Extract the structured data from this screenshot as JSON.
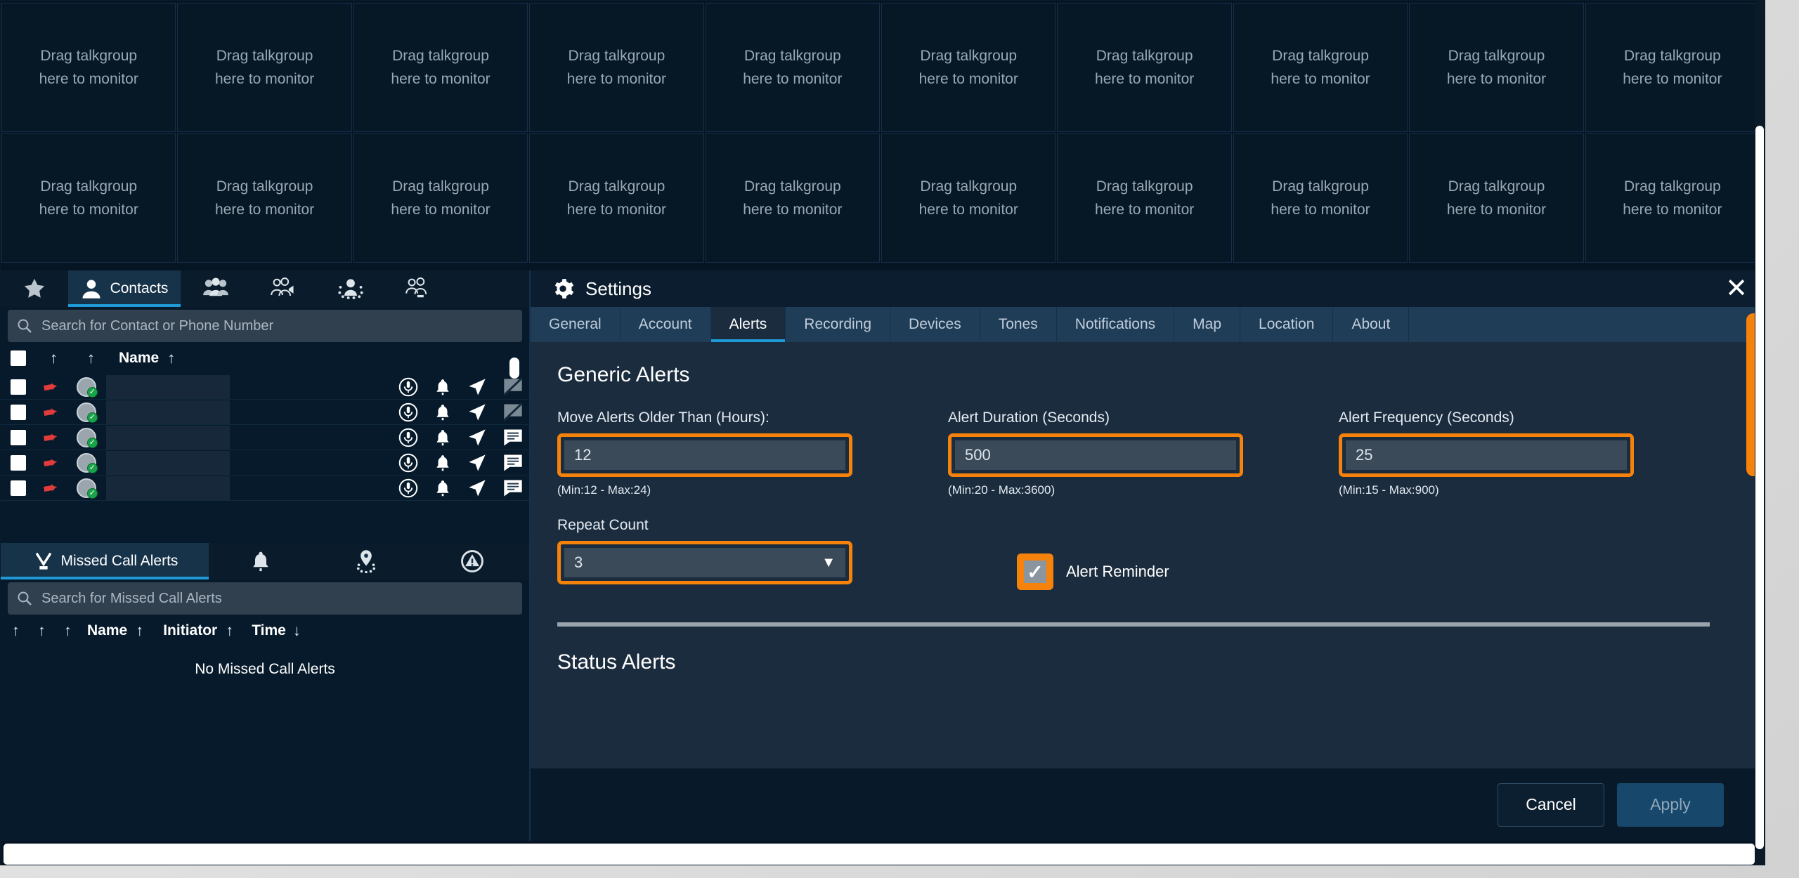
{
  "talkgroups": {
    "placeholder_line1": "Drag talkgroup",
    "placeholder_line2": "here to monitor",
    "columns": 10,
    "rows": 2
  },
  "left_panel": {
    "contacts_tabs": [
      {
        "label": "",
        "icon": "star-icon",
        "active": false
      },
      {
        "label": "Contacts",
        "icon": "person-icon",
        "active": true
      },
      {
        "label": "",
        "icon": "group-icon",
        "active": false
      },
      {
        "label": "",
        "icon": "talkgroup-broadcast-icon",
        "active": false
      },
      {
        "label": "",
        "icon": "group-dashed-icon",
        "active": false
      },
      {
        "label": "",
        "icon": "group-download-icon",
        "active": false
      }
    ],
    "contacts_search_placeholder": "Search for Contact or Phone Number",
    "contacts_columns": [
      "Name"
    ],
    "contact_rows": [
      {
        "chat": "chat-off-icon"
      },
      {
        "chat": "chat-off-icon"
      },
      {
        "chat": "chat-icon"
      },
      {
        "chat": "chat-icon"
      },
      {
        "chat": "chat-icon"
      }
    ],
    "missed_tabs": [
      {
        "label": "Missed Call Alerts",
        "icon": "missed-call-icon",
        "active": true
      },
      {
        "label": "",
        "icon": "bell-icon",
        "active": false
      },
      {
        "label": "",
        "icon": "location-alert-icon",
        "active": false
      },
      {
        "label": "",
        "icon": "emergency-icon",
        "active": false
      }
    ],
    "missed_search_placeholder": "Search for Missed Call Alerts",
    "missed_columns": [
      "Name",
      "Initiator",
      "Time"
    ],
    "missed_empty": "No Missed Call Alerts"
  },
  "settings": {
    "title": "Settings",
    "close_icon": "close-icon",
    "gear_icon": "gear-icon",
    "tabs": [
      {
        "label": "General",
        "active": false
      },
      {
        "label": "Account",
        "active": false
      },
      {
        "label": "Alerts",
        "active": true
      },
      {
        "label": "Recording",
        "active": false
      },
      {
        "label": "Devices",
        "active": false
      },
      {
        "label": "Tones",
        "active": false
      },
      {
        "label": "Notifications",
        "active": false
      },
      {
        "label": "Map",
        "active": false
      },
      {
        "label": "Location",
        "active": false
      },
      {
        "label": "About",
        "active": false
      }
    ],
    "generic_alerts_heading": "Generic Alerts",
    "fields": [
      {
        "label": "Move Alerts Older Than (Hours):",
        "value": "12",
        "hint": "(Min:12 - Max:24)",
        "highlighted": true
      },
      {
        "label": "Alert Duration (Seconds)",
        "value": "500",
        "hint": "(Min:20 - Max:3600)",
        "highlighted": true
      },
      {
        "label": "Alert Frequency (Seconds)",
        "value": "25",
        "hint": "(Min:15 - Max:900)",
        "highlighted": true
      }
    ],
    "repeat_count": {
      "label": "Repeat Count",
      "value": "3",
      "caret": "chevron-down-icon",
      "highlighted": true
    },
    "alert_reminder": {
      "label": "Alert Reminder",
      "checked": true,
      "highlighted": true
    },
    "status_alerts_heading": "Status Alerts",
    "buttons": {
      "cancel": "Cancel",
      "apply": "Apply"
    }
  },
  "colors": {
    "highlight_orange": "#f5820b",
    "accent_cyan": "#1e9bd7",
    "panel_dark": "#071a2b",
    "settings_body": "#1b2c3e",
    "tabbar": "#1f3d57",
    "status_green": "#19a44a",
    "alert_red": "#e23b3b"
  }
}
